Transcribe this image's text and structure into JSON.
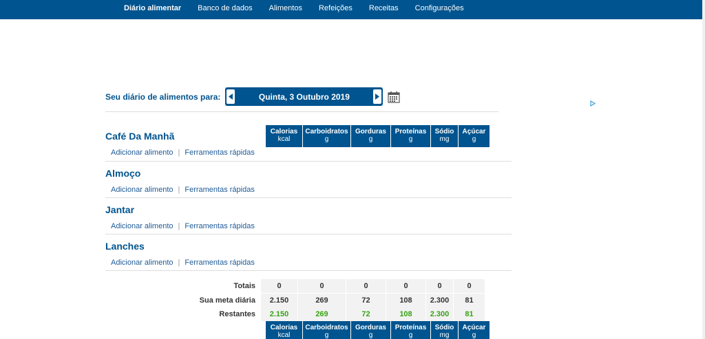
{
  "nav": {
    "items": [
      {
        "label": "Diário alimentar",
        "active": true
      },
      {
        "label": "Banco de dados"
      },
      {
        "label": "Alimentos"
      },
      {
        "label": "Refeições"
      },
      {
        "label": "Receitas"
      },
      {
        "label": "Configurações"
      }
    ]
  },
  "diary": {
    "label": "Seu diário de alimentos para:",
    "date": "Quinta, 3 Outubro 2019"
  },
  "columns": [
    {
      "name": "Calorias",
      "unit": "kcal"
    },
    {
      "name": "Carboidratos",
      "unit": "g"
    },
    {
      "name": "Gorduras",
      "unit": "g"
    },
    {
      "name": "Proteínas",
      "unit": "g"
    },
    {
      "name": "Sódio",
      "unit": "mg"
    },
    {
      "name": "Açúcar",
      "unit": "g"
    }
  ],
  "meals": [
    {
      "title": "Café Da Manhã",
      "add": "Adicionar alimento",
      "tools": "Ferramentas rápidas"
    },
    {
      "title": "Almoço",
      "add": "Adicionar alimento",
      "tools": "Ferramentas rápidas"
    },
    {
      "title": "Jantar",
      "add": "Adicionar alimento",
      "tools": "Ferramentas rápidas"
    },
    {
      "title": "Lanches",
      "add": "Adicionar alimento",
      "tools": "Ferramentas rápidas"
    }
  ],
  "summary": {
    "totals": {
      "label": "Totais",
      "values": [
        "0",
        "0",
        "0",
        "0",
        "0",
        "0"
      ]
    },
    "goal": {
      "label": "Sua meta diária",
      "values": [
        "2.150",
        "269",
        "72",
        "108",
        "2.300",
        "81"
      ]
    },
    "remaining": {
      "label": "Restantes",
      "values": [
        "2.150",
        "269",
        "72",
        "108",
        "2.300",
        "81"
      ]
    }
  },
  "colors": {
    "brand": "#00548f",
    "remaining": "#36a314"
  }
}
